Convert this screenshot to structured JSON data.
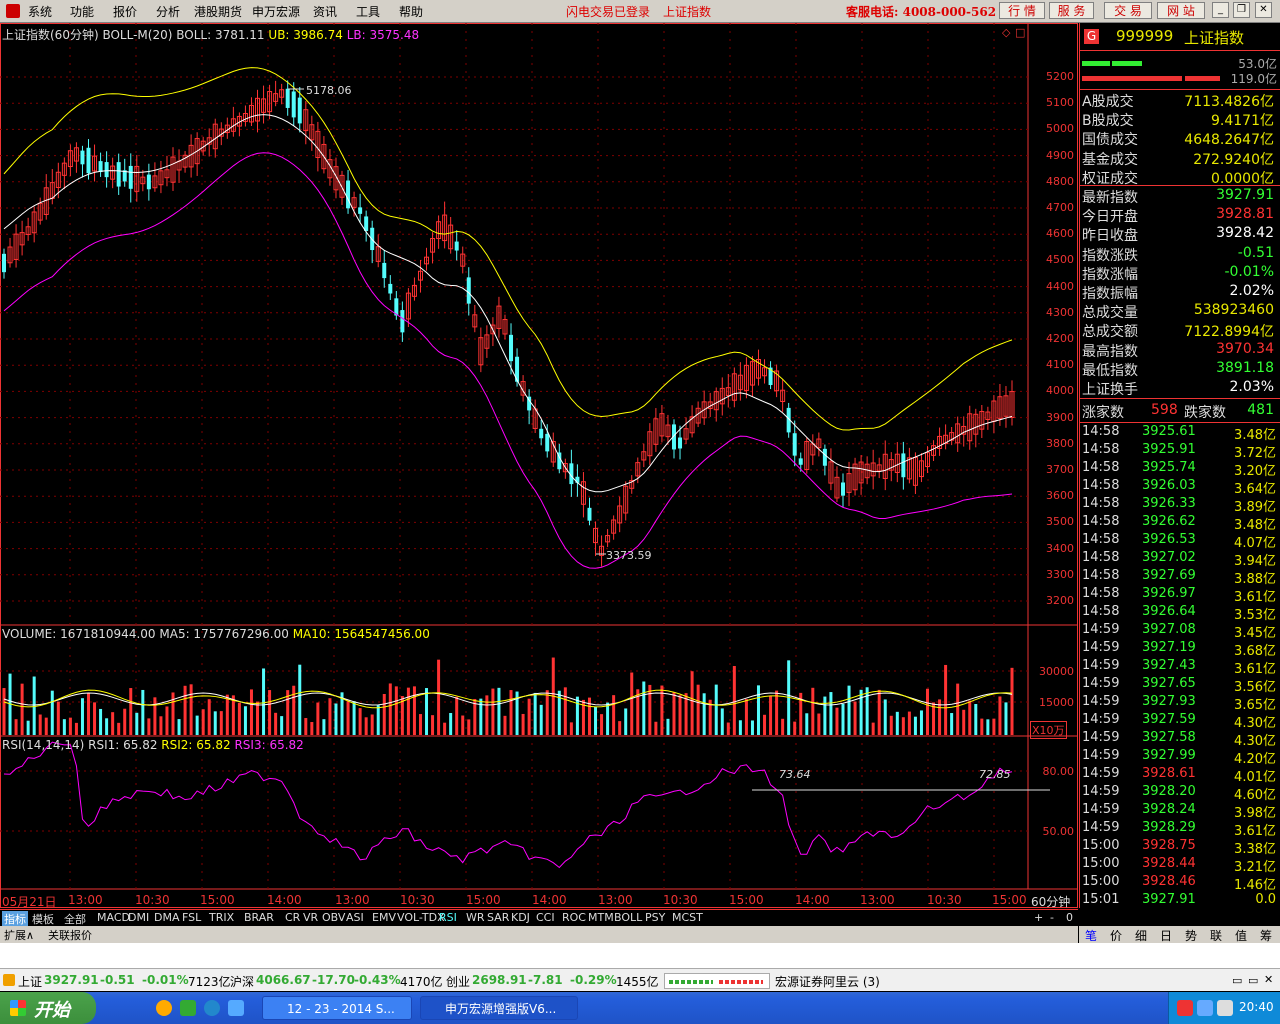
{
  "menu": {
    "items": [
      "系统",
      "功能",
      "报价",
      "分析",
      "港股期货",
      "申万宏源",
      "资讯",
      "工具",
      "帮助"
    ],
    "status_login": "闪电交易已登录",
    "status_index": "上证指数",
    "hotline": "客服电话: 4008-000-562",
    "buttons": [
      "行 情",
      "服 务",
      "交 易",
      "网 站"
    ]
  },
  "chart": {
    "main_header": {
      "title": "上证指数(60分钟)",
      "indicator": "BOLL-M(20)",
      "boll": "BOLL: 3781.11",
      "ub": "UB: 3986.74",
      "lb": "LB: 3575.48"
    },
    "high_marker": "5178.06",
    "low_marker": "3373.59",
    "price_axis": [
      "5200",
      "5100",
      "5000",
      "4900",
      "4800",
      "4700",
      "4600",
      "4500",
      "4400",
      "4300",
      "4200",
      "4100",
      "4000",
      "3900",
      "3800",
      "3700",
      "3600",
      "3500",
      "3400",
      "3300",
      "3200"
    ],
    "volume_header": {
      "volume": "VOLUME: 1671810944.00",
      "ma5": "MA5: 1757767296.00",
      "ma10": "MA10: 1564547456.00"
    },
    "volume_axis": [
      "30000",
      "15000"
    ],
    "volume_unit": "X10万",
    "rsi_header": {
      "name": "RSI(14,14,14)",
      "rsi1": "RSI1: 65.82",
      "rsi2": "RSI2: 65.82",
      "rsi3": "RSI3: 65.82"
    },
    "rsi_axis": [
      "80.00",
      "50.00"
    ],
    "rsi_marks": [
      "73.64",
      "72.85"
    ],
    "time_axis": [
      "05月21日",
      "13:00",
      "10:30",
      "15:00",
      "14:00",
      "13:00",
      "10:30",
      "15:00",
      "14:00",
      "13:00",
      "10:30",
      "15:00",
      "14:00",
      "13:00",
      "10:30",
      "15:00"
    ],
    "period": "60分钟",
    "colors": {
      "up": "#ff3333",
      "down": "#54fcfc",
      "boll_mid": "#ffffff",
      "boll_ub": "#ffff00",
      "boll_lb": "#ff00ff",
      "ma5": "#ffffff",
      "ma10": "#ffff00",
      "rsi": "#ff00ff",
      "grid": "#800000"
    }
  },
  "tabs": {
    "indicators": [
      "指标",
      "模板",
      "全部",
      "MACD",
      "DMI",
      "DMA",
      "FSL",
      "TRIX",
      "BRAR",
      "CR",
      "VR",
      "OBV",
      "ASI",
      "EMV",
      "VOL-TDX",
      "RSI",
      "WR",
      "SAR",
      "KDJ",
      "CCI",
      "ROC",
      "MTM",
      "BOLL",
      "PSY",
      "MCST"
    ],
    "active": "RSI",
    "bottom": [
      "扩展∧",
      "关联报价"
    ],
    "controls": [
      "+",
      "-",
      "0"
    ]
  },
  "quote": {
    "badge": "G",
    "code": "999999",
    "name": "上证指数",
    "bar_top_value": "53.0亿",
    "bar_bottom_value": "119.0亿",
    "rows": [
      {
        "label": "A股成交",
        "value": "7113.4826亿",
        "color": "#e8e800"
      },
      {
        "label": "B股成交",
        "value": "9.4171亿",
        "color": "#e8e800"
      },
      {
        "label": "国债成交",
        "value": "4648.2647亿",
        "color": "#e8e800"
      },
      {
        "label": "基金成交",
        "value": "272.9240亿",
        "color": "#e8e800"
      },
      {
        "label": "权证成交",
        "value": "0.0000亿",
        "color": "#e8e800"
      },
      {
        "label": "最新指数",
        "value": "3927.91",
        "color": "#33ff33"
      },
      {
        "label": "今日开盘",
        "value": "3928.81",
        "color": "#ff3333"
      },
      {
        "label": "昨日收盘",
        "value": "3928.42",
        "color": "#ffffff"
      },
      {
        "label": "指数涨跌",
        "value": "-0.51",
        "color": "#33ff33"
      },
      {
        "label": "指数涨幅",
        "value": "-0.01%",
        "color": "#33ff33"
      },
      {
        "label": "指数振幅",
        "value": "2.02%",
        "color": "#ffffff"
      },
      {
        "label": "总成交量",
        "value": "538923460",
        "color": "#e8e800"
      },
      {
        "label": "总成交额",
        "value": "7122.8994亿",
        "color": "#e8e800"
      },
      {
        "label": "最高指数",
        "value": "3970.34",
        "color": "#ff3333"
      },
      {
        "label": "最低指数",
        "value": "3891.18",
        "color": "#33ff33"
      },
      {
        "label": "上证换手",
        "value": "2.03%",
        "color": "#ffffff"
      }
    ],
    "advance_label": "涨家数",
    "advance_value": "598",
    "decline_label": "跌家数",
    "decline_value": "481",
    "ticks": [
      {
        "t": "14:58",
        "p": "3925.61",
        "v": "3.48亿",
        "c": "#33ff33"
      },
      {
        "t": "14:58",
        "p": "3925.91",
        "v": "3.72亿",
        "c": "#33ff33"
      },
      {
        "t": "14:58",
        "p": "3925.74",
        "v": "3.20亿",
        "c": "#33ff33"
      },
      {
        "t": "14:58",
        "p": "3926.03",
        "v": "3.64亿",
        "c": "#33ff33"
      },
      {
        "t": "14:58",
        "p": "3926.33",
        "v": "3.89亿",
        "c": "#33ff33"
      },
      {
        "t": "14:58",
        "p": "3926.62",
        "v": "3.48亿",
        "c": "#33ff33"
      },
      {
        "t": "14:58",
        "p": "3926.53",
        "v": "4.07亿",
        "c": "#33ff33"
      },
      {
        "t": "14:58",
        "p": "3927.02",
        "v": "3.94亿",
        "c": "#33ff33"
      },
      {
        "t": "14:58",
        "p": "3927.69",
        "v": "3.88亿",
        "c": "#33ff33"
      },
      {
        "t": "14:58",
        "p": "3926.97",
        "v": "3.61亿",
        "c": "#33ff33"
      },
      {
        "t": "14:58",
        "p": "3926.64",
        "v": "3.53亿",
        "c": "#33ff33"
      },
      {
        "t": "14:59",
        "p": "3927.08",
        "v": "3.45亿",
        "c": "#33ff33"
      },
      {
        "t": "14:59",
        "p": "3927.19",
        "v": "3.68亿",
        "c": "#33ff33"
      },
      {
        "t": "14:59",
        "p": "3927.43",
        "v": "3.61亿",
        "c": "#33ff33"
      },
      {
        "t": "14:59",
        "p": "3927.65",
        "v": "3.56亿",
        "c": "#33ff33"
      },
      {
        "t": "14:59",
        "p": "3927.93",
        "v": "3.65亿",
        "c": "#33ff33"
      },
      {
        "t": "14:59",
        "p": "3927.59",
        "v": "4.30亿",
        "c": "#33ff33"
      },
      {
        "t": "14:59",
        "p": "3927.58",
        "v": "4.30亿",
        "c": "#33ff33"
      },
      {
        "t": "14:59",
        "p": "3927.99",
        "v": "4.20亿",
        "c": "#33ff33"
      },
      {
        "t": "14:59",
        "p": "3928.61",
        "v": "4.01亿",
        "c": "#ff3333"
      },
      {
        "t": "14:59",
        "p": "3928.20",
        "v": "4.60亿",
        "c": "#33ff33"
      },
      {
        "t": "14:59",
        "p": "3928.24",
        "v": "3.98亿",
        "c": "#33ff33"
      },
      {
        "t": "14:59",
        "p": "3928.29",
        "v": "3.61亿",
        "c": "#33ff33"
      },
      {
        "t": "15:00",
        "p": "3928.75",
        "v": "3.38亿",
        "c": "#ff3333"
      },
      {
        "t": "15:00",
        "p": "3928.44",
        "v": "3.21亿",
        "c": "#ff3333"
      },
      {
        "t": "15:00",
        "p": "3928.46",
        "v": "1.46亿",
        "c": "#ff3333"
      },
      {
        "t": "15:01",
        "p": "3927.91",
        "v": "0.0",
        "c": "#33ff33"
      }
    ],
    "right_tabs": [
      "笔",
      "价",
      "细",
      "日",
      "势",
      "联",
      "值",
      "筹"
    ]
  },
  "ticker": {
    "items": [
      {
        "name": "上证",
        "price": "3927.91",
        "chg": "-0.51",
        "pct": "-0.01%",
        "amt": "7123亿"
      },
      {
        "name": "沪深",
        "price": "4066.67",
        "chg": "-17.70",
        "pct": "-0.43%",
        "amt": "4170亿"
      },
      {
        "name": "创业",
        "price": "2698.91",
        "chg": "-7.81",
        "pct": "-0.29%",
        "amt": "1455亿"
      }
    ],
    "broker": "宏源证券阿里云 (3)"
  },
  "taskbar": {
    "start": "开始",
    "items": [
      "12 - 23 - 2014 S...",
      "申万宏源增强版V6..."
    ],
    "clock": "20:40"
  }
}
